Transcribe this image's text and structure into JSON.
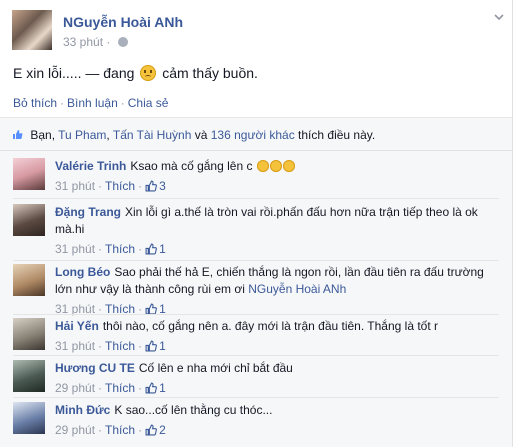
{
  "post": {
    "author": "NGuyễn Hoài ANh",
    "time": "33 phút",
    "status_prefix": "E xin lỗi..... — đang",
    "status_feeling": "cảm thấy buồn.",
    "actions": {
      "like": "Bỏ thích",
      "comment": "Bình luận",
      "share": "Chia sẻ",
      "dot": "·"
    }
  },
  "likes": {
    "prefix": "Bạn,",
    "friend1": "Tu Pham",
    "comma": ",",
    "friend2": "Tấn Tài Huỳnh",
    "and": "và",
    "others": "136 người khác",
    "suffix": "thích điều này."
  },
  "comments": [
    {
      "name": "Valérie Trinh",
      "text": "Ksao mà cố gắng lên c",
      "time": "31 phút",
      "like": "Thích",
      "count": "3",
      "avatar_color": "#d79aa3"
    },
    {
      "name": "Đặng Trang",
      "text": "Xin lỗi gì a.thế là tròn vai rồi.phấn đấu hơn nữa trận tiếp theo là ok mà.hi",
      "time": "31 phút",
      "like": "Thích",
      "count": "1",
      "avatar_color": "#5b4a42"
    },
    {
      "name": "Long Béo",
      "text": "Sao phải thế hả E, chiến thắng là ngon rồi, lần đầu tiên ra đấu trường lớn như vậy là thành công rùi em ơi",
      "tag": "NGuyễn Hoài ANh",
      "time": "31 phút",
      "like": "Thích",
      "count": "1",
      "avatar_color": "#b08a66"
    },
    {
      "name": "Hải Yến",
      "text": "thôi nào, cố gắng nên a. đây mới là trận đầu tiên. Thắng là tốt r",
      "time": "31 phút",
      "like": "Thích",
      "count": "1",
      "avatar_color": "#8a8377"
    },
    {
      "name": "Hương CU TE",
      "text": "Cố lên e nha mới chỉ bắt đầu",
      "time": "29 phút",
      "like": "Thích",
      "count": "1",
      "avatar_color": "#4a5a52"
    },
    {
      "name": "Minh Đức",
      "text": "K sao...cố lên thằng cu thóc...",
      "time": "29 phút",
      "like": "Thích",
      "count": "2",
      "avatar_color": "#6a7fa8"
    }
  ]
}
